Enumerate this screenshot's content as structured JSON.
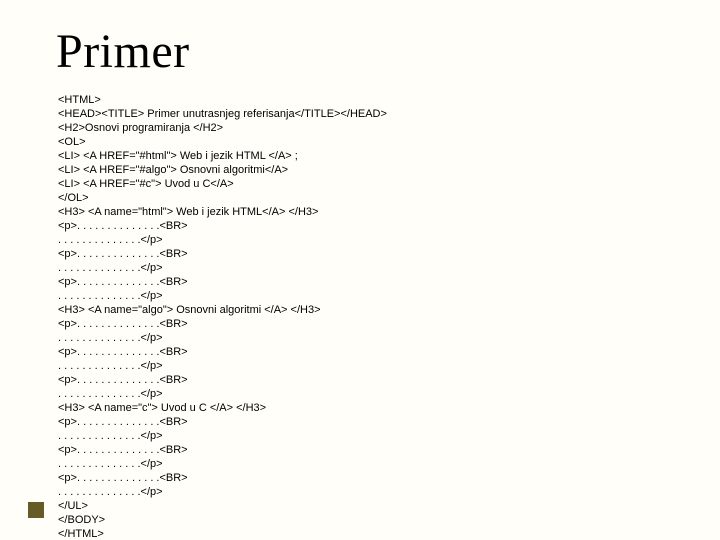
{
  "title": "Primer",
  "code": {
    "lines": [
      "<HTML>",
      "<HEAD><TITLE> Primer unutrasnjeg referisanja</TITLE></HEAD>",
      "<H2>Osnovi programiranja </H2>",
      "<OL>",
      "<LI> <A HREF=\"#html\"> Web i jezik HTML </A> ;",
      "<LI> <A HREF=\"#algo\"> Osnovni algoritmi</A>",
      "<LI> <A HREF=\"#c\"> Uvod u C</A>",
      "</OL>",
      "<H3> <A name=\"html\"> Web i jezik HTML</A> </H3>",
      "<p>. . . . . . . . . . . . . .<BR>",
      ". . . . . . . . . . . . . .</p>",
      "<p>. . . . . . . . . . . . . .<BR>",
      ". . . . . . . . . . . . . .</p>",
      "<p>. . . . . . . . . . . . . .<BR>",
      ". . . . . . . . . . . . . .</p>",
      "<H3> <A name=\"algo\"> Osnovni algoritmi </A> </H3>",
      "<p>. . . . . . . . . . . . . .<BR>",
      ". . . . . . . . . . . . . .</p>",
      "<p>. . . . . . . . . . . . . .<BR>",
      ". . . . . . . . . . . . . .</p>",
      "<p>. . . . . . . . . . . . . .<BR>",
      ". . . . . . . . . . . . . .</p>",
      "<H3> <A name=\"c\"> Uvod u C </A> </H3>",
      "<p>. . . . . . . . . . . . . .<BR>",
      ". . . . . . . . . . . . . .</p>",
      "<p>. . . . . . . . . . . . . .<BR>",
      ". . . . . . . . . . . . . .</p>",
      "<p>. . . . . . . . . . . . . .<BR>",
      ". . . . . . . . . . . . . .</p>",
      "</UL>",
      "</BODY>",
      "</HTML>"
    ]
  }
}
